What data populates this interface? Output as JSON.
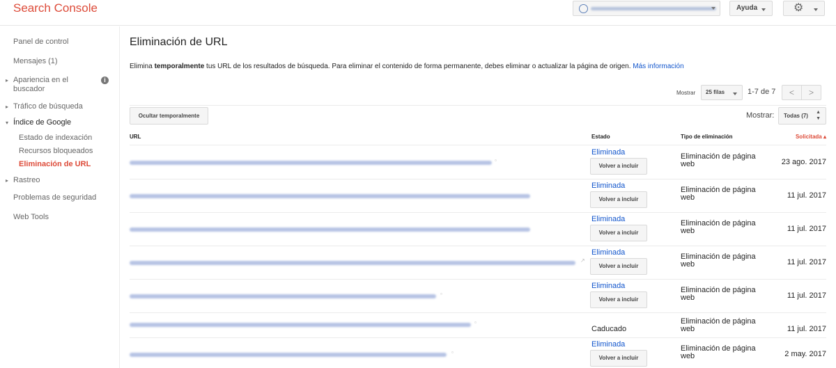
{
  "header": {
    "logo": "Search Console",
    "help_label": "Ayuda",
    "settings_icon": "gear-icon",
    "site_icon": "globe-icon"
  },
  "sidebar": {
    "items": {
      "dashboard": "Panel de control",
      "messages": "Mensajes (1)",
      "appearance": "Apariencia en el buscador",
      "traffic": "Tráfico de búsqueda",
      "google_index": "Índice de Google",
      "index_status": "Estado de indexación",
      "blocked_resources": "Recursos bloqueados",
      "url_removal": "Eliminación de URL",
      "crawl": "Rastreo",
      "security": "Problemas de seguridad",
      "web_tools": "Web Tools"
    },
    "info_glyph": "i"
  },
  "main": {
    "title": "Eliminación de URL",
    "desc_pre": "Elimina ",
    "desc_bold": "temporalmente",
    "desc_post": " tus URL de los resultados de búsqueda. Para eliminar el contenido de forma permanente, debes eliminar o actualizar la página de origen. ",
    "desc_link": "Más información",
    "pager": {
      "show_label": "Mostrar",
      "rows_value": "25 filas",
      "range": "1-7 de 7",
      "prev": "<",
      "next": ">"
    },
    "hide_button": "Ocultar temporalmente",
    "filter": {
      "label": "Mostrar:",
      "value": "Todas (7)"
    },
    "columns": {
      "url": "URL",
      "status": "Estado",
      "type": "Tipo de eliminación",
      "requested": "Solicitada ▴"
    },
    "rows": [
      {
        "status": "Eliminada",
        "button": "Volver a incluir",
        "type": "Eliminación de página web",
        "date": "23 ago. 2017"
      },
      {
        "status": "Eliminada",
        "button": "Volver a incluir",
        "type": "Eliminación de página web",
        "date": "11 jul. 2017"
      },
      {
        "status": "Eliminada",
        "button": "Volver a incluir",
        "type": "Eliminación de página web",
        "date": "11 jul. 2017"
      },
      {
        "status": "Eliminada",
        "button": "Volver a incluir",
        "type": "Eliminación de página web",
        "date": "11 jul. 2017"
      },
      {
        "status": "Eliminada",
        "button": "Volver a incluir",
        "type": "Eliminación de página web",
        "date": "11 jul. 2017"
      },
      {
        "status": "Caducado",
        "type": "Eliminación de página web",
        "date": "11 jul. 2017"
      },
      {
        "status": "Eliminada",
        "button": "Volver a incluir",
        "type": "Eliminación de página web",
        "date": "2 may. 2017"
      }
    ]
  }
}
